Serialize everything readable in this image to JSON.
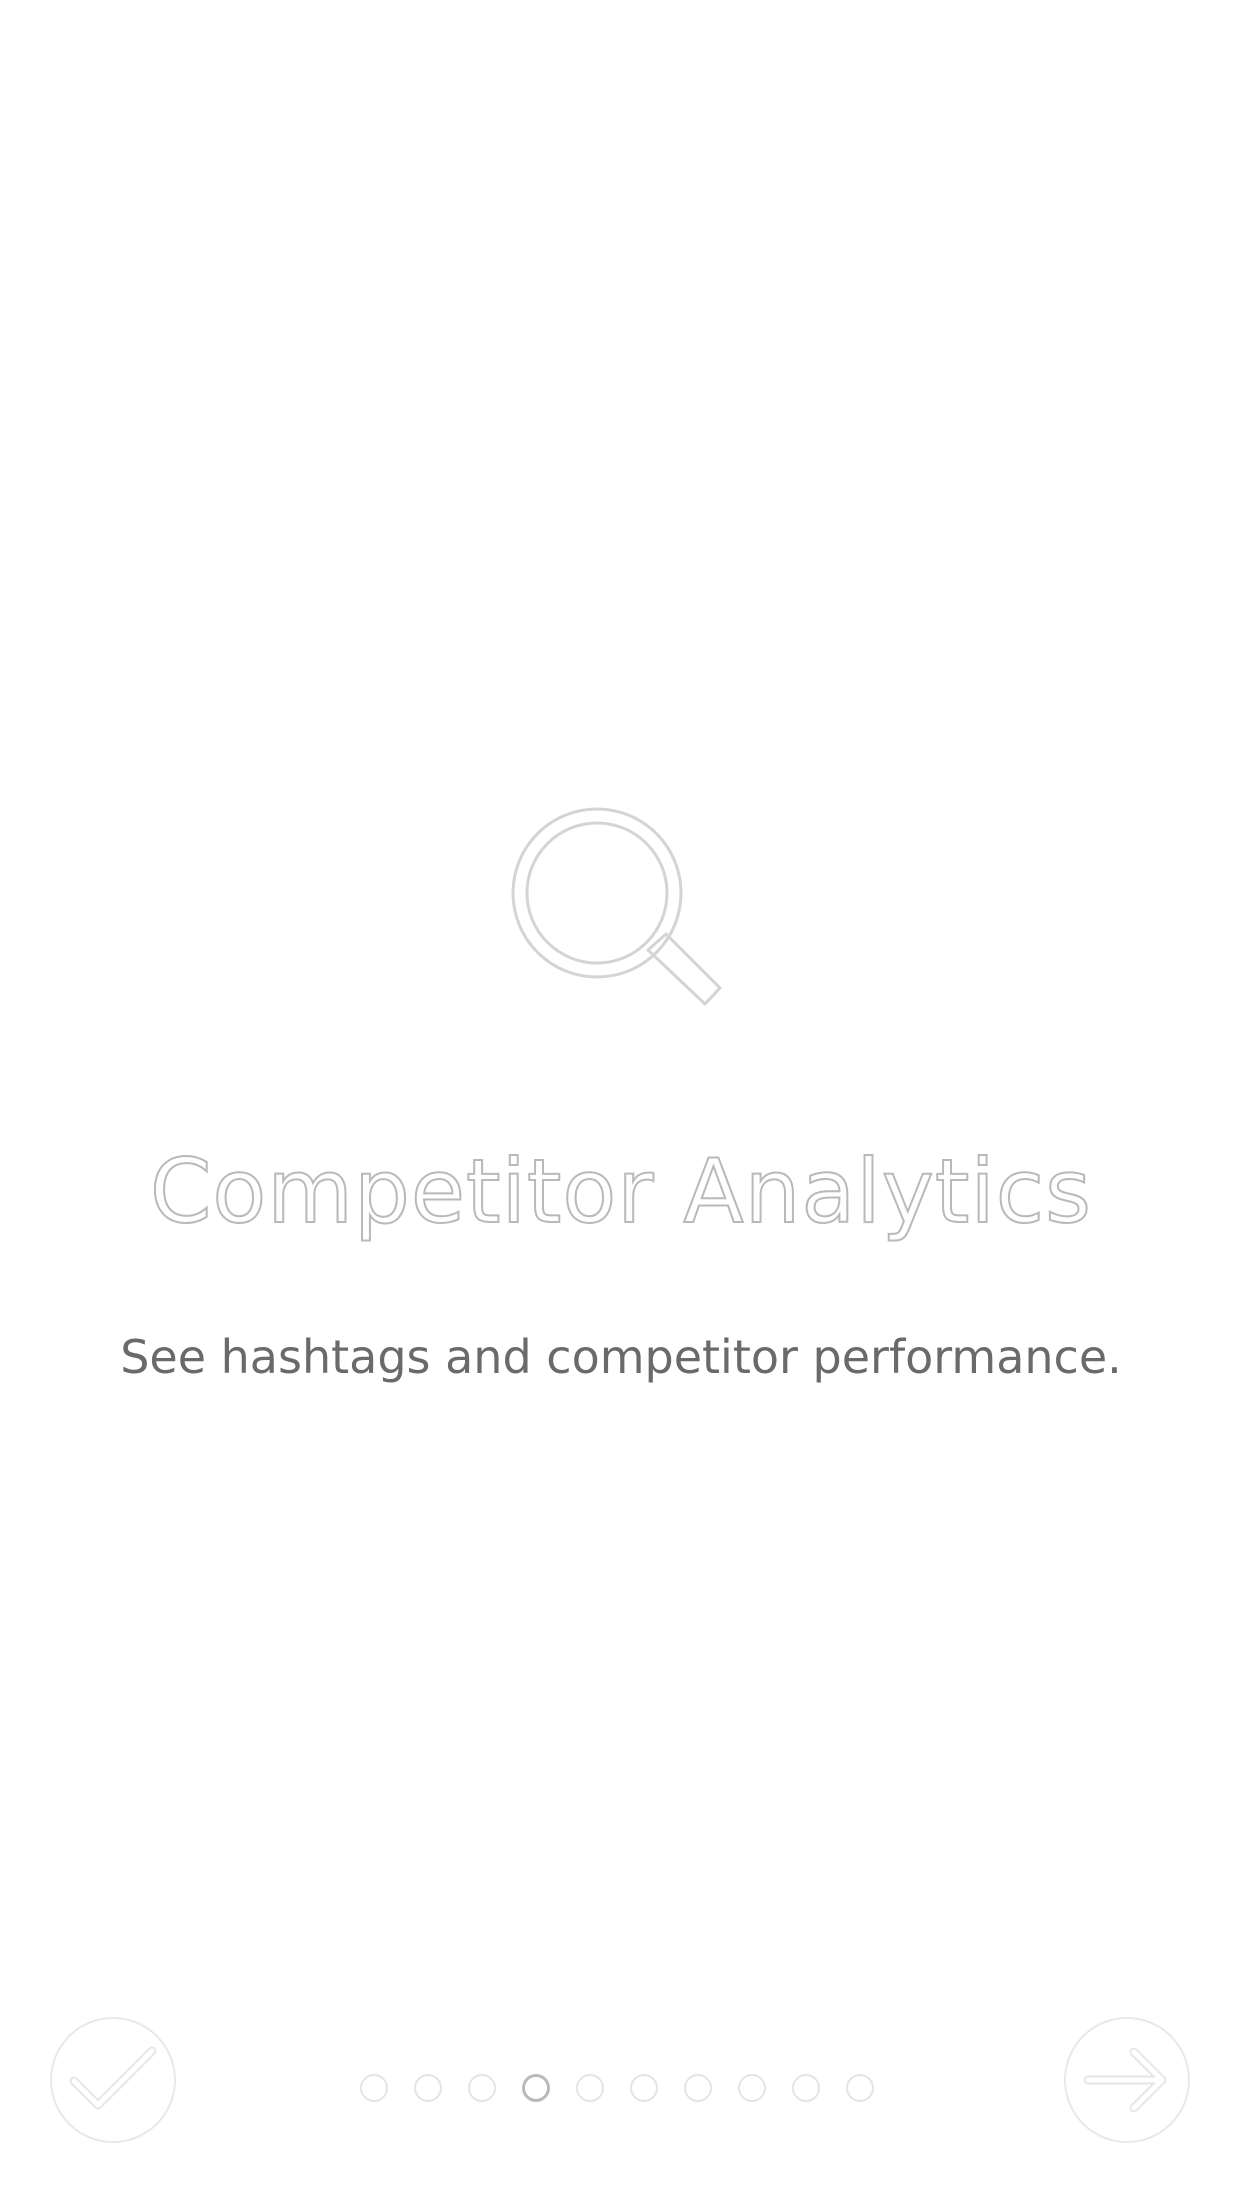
{
  "onboarding": {
    "title": "Competitor Analytics",
    "subtitle": "See hashtags and competitor performance.",
    "hero_icon": "search-icon"
  },
  "controls": {
    "left_icon": "checkmark-icon",
    "right_icon": "arrow-right-icon"
  },
  "pager": {
    "total_pages": 10,
    "current_page": 4
  },
  "colors": {
    "background": "#ffffff",
    "icon_stroke": "#cfcfcf",
    "title_outline": "#b9b9b9",
    "subtitle": "#6a6a6a",
    "control_outline": "#e8e8e8"
  }
}
